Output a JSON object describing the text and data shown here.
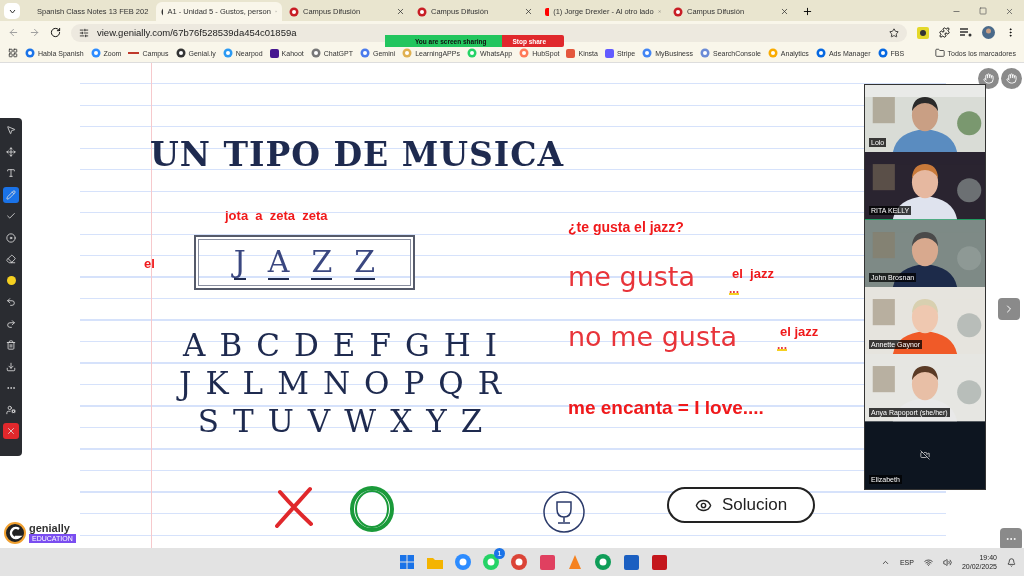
{
  "browser": {
    "tabs": [
      {
        "title": "Spanish Class Notes 13 FEB 202",
        "selected": false
      },
      {
        "title": "A1 - Unidad 5 - Gustos, person",
        "selected": true
      },
      {
        "title": "Campus Difusión",
        "selected": false
      },
      {
        "title": "Campus Difusión",
        "selected": false
      },
      {
        "title": "(1) Jorge Drexler - Al otro lado",
        "selected": false
      },
      {
        "title": "Campus Difusión",
        "selected": false
      }
    ],
    "address": "view.genially.com/67b76f528539da454c01859a",
    "bookmarks": [
      "Habla Spanish",
      "Zoom",
      "Campus",
      "Genial.ly",
      "Nearpod",
      "Kahoot",
      "ChatGPT",
      "Gemini",
      "LearningAPPs",
      "WhatsApp",
      "HubSpot",
      "Kinsta",
      "Stripe",
      "MyBusiness",
      "SearchConsole",
      "Analytics",
      "Ads Manager",
      "FBS"
    ],
    "all_bookmarks": "Todos los marcadores"
  },
  "share_banner": {
    "status": "You are screen sharing",
    "stop": "Stop share"
  },
  "toolbar": {
    "tools": [
      {
        "kind": "select",
        "selected": false
      },
      {
        "kind": "move",
        "selected": false
      },
      {
        "kind": "text",
        "selected": false
      },
      {
        "kind": "pen",
        "selected": true
      },
      {
        "kind": "check",
        "selected": false
      },
      {
        "kind": "target",
        "selected": false
      },
      {
        "kind": "eraser",
        "selected": false
      },
      {
        "kind": "color",
        "selected": false
      },
      {
        "kind": "undo",
        "selected": false
      },
      {
        "kind": "redo",
        "selected": false
      },
      {
        "kind": "trash",
        "selected": false
      },
      {
        "kind": "download",
        "selected": false
      },
      {
        "kind": "more",
        "selected": false
      },
      {
        "kind": "user",
        "selected": false
      },
      {
        "kind": "close",
        "selected": false
      }
    ]
  },
  "slide": {
    "title": "UN TIPO DE MUSICA",
    "spelling": "jota  a  zeta  zeta",
    "article": "el",
    "word_letters": [
      "J",
      "A",
      "Z",
      "Z"
    ],
    "alphabet_rows": [
      [
        "A",
        "B",
        "C",
        "D",
        "E",
        "F",
        "G",
        "H",
        "I"
      ],
      [
        "J",
        "K",
        "L",
        "M",
        "N",
        "O",
        "P",
        "Q",
        "R"
      ],
      [
        "S",
        "T",
        "U",
        "V",
        "W",
        "X",
        "Y",
        "Z"
      ]
    ],
    "question": "¿te gusta el jazz?",
    "answers": [
      {
        "phrase": "me gusta",
        "object": "el  jazz",
        "blank": "..."
      },
      {
        "phrase": "no me gusta",
        "object": "el jazz",
        "blank": "..."
      }
    ],
    "note": "me encanta = I love....",
    "solution_button": "Solucion",
    "brand": "genially",
    "brand_badge": "EDUCATION"
  },
  "video_panel": {
    "participants": [
      {
        "name": "Lolo",
        "active": false,
        "camera": true
      },
      {
        "name": "RITA KELLY",
        "active": true,
        "camera": true
      },
      {
        "name": "John Brosnan",
        "active": false,
        "camera": true
      },
      {
        "name": "Annette Gaynor",
        "active": false,
        "camera": true
      },
      {
        "name": "Anya Rapoport (she/her)",
        "active": false,
        "camera": true
      },
      {
        "name": "Elizabeth",
        "active": false,
        "camera": false
      }
    ]
  },
  "taskbar": {
    "apps": [
      {
        "kind": "start"
      },
      {
        "kind": "files"
      },
      {
        "kind": "zoom"
      },
      {
        "kind": "whatsapp",
        "badge": "1"
      },
      {
        "kind": "chrome"
      },
      {
        "kind": "snip"
      },
      {
        "kind": "vlc"
      },
      {
        "kind": "chrome2"
      },
      {
        "kind": "mail"
      },
      {
        "kind": "pdf"
      }
    ],
    "language": "ESP",
    "time": "19:40",
    "date": "20/02/2025"
  }
}
